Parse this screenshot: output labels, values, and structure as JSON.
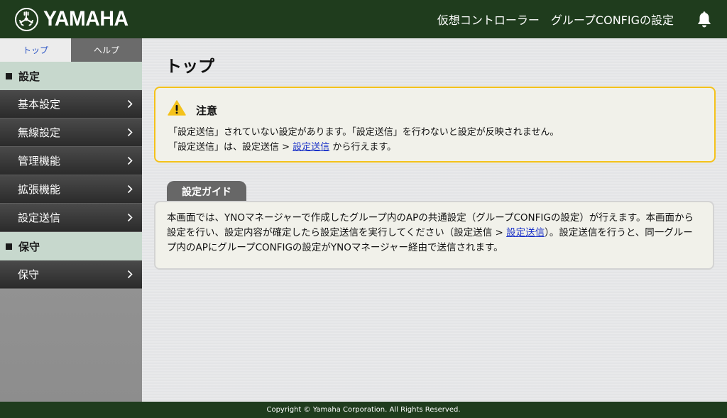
{
  "header": {
    "brand": "YAMAHA",
    "title_part1": "仮想コントローラー",
    "title_part2": "グループCONFIGの設定"
  },
  "sidebar": {
    "tabs": [
      {
        "label": "トップ",
        "active": true
      },
      {
        "label": "ヘルプ",
        "active": false
      }
    ],
    "sections": [
      {
        "label": "設定",
        "items": [
          "基本設定",
          "無線設定",
          "管理機能",
          "拡張機能",
          "設定送信"
        ]
      },
      {
        "label": "保守",
        "items": [
          "保守"
        ]
      }
    ]
  },
  "main": {
    "page_title": "トップ",
    "notice": {
      "title": "注意",
      "line1": "「設定送信」されていない設定があります。「設定送信」を行わないと設定が反映されません。",
      "line2_prefix": "「設定送信」は、設定送信 > ",
      "line2_link": "設定送信",
      "line2_suffix": " から行えます。"
    },
    "guide": {
      "tab_label": "設定ガイド",
      "text_prefix": "本画面では、YNOマネージャーで作成したグループ内のAPの共通設定（グループCONFIGの設定）が行えます。本画面から設定を行い、設定内容が確定したら設定送信を実行してください（設定送信 > ",
      "link": "設定送信",
      "text_suffix": "）。設定送信を行うと、同一グループ内のAPにグループCONFIGの設定がYNOマネージャー経由で送信されます。"
    }
  },
  "footer": {
    "copyright": "Copyright © Yamaha Corporation. All Rights Reserved."
  },
  "colors": {
    "header_bg": "#1f3c1d",
    "notice_border": "#f4c21b",
    "link": "#1d34c8",
    "section_bg": "#c7d8cd"
  }
}
